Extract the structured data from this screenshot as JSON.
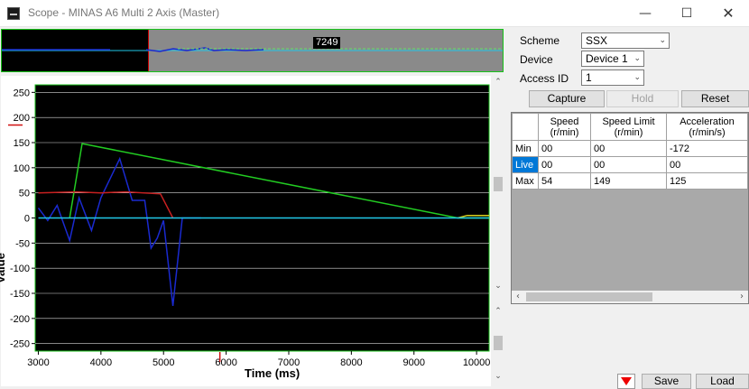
{
  "window": {
    "title": "Scope - MINAS A6 Multi 2 Axis (Master)",
    "min_glyph": "—",
    "max_glyph": "☐",
    "close_glyph": "✕"
  },
  "overview": {
    "cursor_label": "7249"
  },
  "controls": {
    "scheme_label": "Scheme",
    "scheme_value": "SSX",
    "device_label": "Device",
    "device_value": "Device 1",
    "access_label": "Access ID",
    "access_value": "1"
  },
  "buttons": {
    "capture": "Capture",
    "hold": "Hold",
    "reset": "Reset",
    "save": "Save",
    "load": "Load"
  },
  "grid": {
    "headers": [
      {
        "line1": "Speed",
        "line2": "(r/min)"
      },
      {
        "line1": "Speed Limit",
        "line2": "(r/min)"
      },
      {
        "line1": "Acceleration",
        "line2": "(r/min/s)"
      }
    ],
    "rows": [
      {
        "label": "Min",
        "values": [
          "00",
          "00",
          "-172"
        ]
      },
      {
        "label": "Live",
        "values": [
          "00",
          "00",
          "00"
        ]
      },
      {
        "label": "Max",
        "values": [
          "54",
          "149",
          "125"
        ]
      }
    ]
  },
  "chart_data": {
    "type": "line",
    "xlabel": "Time (ms)",
    "ylabel": "Value",
    "xlim": [
      2950,
      10200
    ],
    "ylim": [
      -265,
      265
    ],
    "x_ticks": [
      3000,
      4000,
      5000,
      6000,
      7000,
      8000,
      9000,
      10000
    ],
    "y_ticks": [
      250,
      200,
      150,
      100,
      50,
      0,
      -50,
      -100,
      -150,
      -200,
      -250
    ],
    "grid": true,
    "series": [
      {
        "color": "#22cc22",
        "points": [
          [
            3500,
            0
          ],
          [
            3700,
            148
          ],
          [
            9700,
            0
          ],
          [
            10200,
            0
          ]
        ]
      },
      {
        "color": "#1a2ad0",
        "points": [
          [
            3000,
            20
          ],
          [
            3150,
            -5
          ],
          [
            3300,
            25
          ],
          [
            3500,
            -45
          ],
          [
            3650,
            40
          ],
          [
            3850,
            -25
          ],
          [
            4000,
            40
          ],
          [
            4300,
            118
          ],
          [
            4500,
            35
          ],
          [
            4700,
            35
          ],
          [
            4800,
            -60
          ],
          [
            4900,
            -40
          ],
          [
            5000,
            -5
          ],
          [
            5150,
            -175
          ],
          [
            5300,
            0
          ],
          [
            5600,
            0
          ]
        ]
      },
      {
        "color": "#c82020",
        "points": [
          [
            3000,
            50
          ],
          [
            3600,
            52
          ],
          [
            4000,
            50
          ],
          [
            4400,
            52
          ],
          [
            4950,
            48
          ],
          [
            5150,
            0
          ]
        ]
      },
      {
        "color": "#d8d020",
        "points": [
          [
            9700,
            0
          ],
          [
            9850,
            5
          ],
          [
            10200,
            5
          ]
        ]
      },
      {
        "color": "#20c8e8",
        "points": [
          [
            3000,
            0
          ],
          [
            10200,
            0
          ]
        ]
      }
    ],
    "markers": [
      {
        "axis": "x",
        "value": 5900,
        "color": "#d01010"
      },
      {
        "axis": "y",
        "value": 185,
        "color": "#d01010"
      }
    ]
  }
}
